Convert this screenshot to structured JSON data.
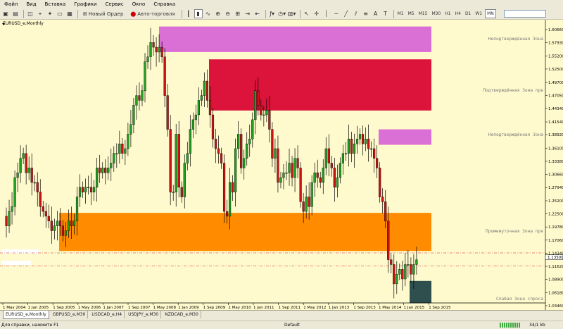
{
  "menu": [
    "Файл",
    "Вид",
    "Вставка",
    "Графики",
    "Сервис",
    "Окно",
    "Справка"
  ],
  "toolbar": {
    "new_order": "Новый Ордер",
    "auto_trading": "Авто-торговля",
    "timeframes": [
      "M1",
      "M5",
      "M15",
      "M30",
      "H1",
      "H4",
      "D1",
      "W1",
      "MN"
    ],
    "active_timeframe": "MN"
  },
  "chart": {
    "title": "EURUSD_e,Monthly",
    "price_labels": [
      "1.60660",
      "1.57930",
      "1.55200",
      "1.52500",
      "1.49700",
      "1.47050",
      "1.44340",
      "1.41540",
      "1.38920",
      "1.36100",
      "1.33380",
      "1.30660",
      "1.27940",
      "1.25200",
      "1.22500",
      "1.19780",
      "1.17060",
      "1.14340",
      "1.11620",
      "1.08900",
      "1.06180",
      "1.03460"
    ],
    "current_price": "1.13500",
    "date_labels": [
      "1 May 2004",
      "1 Jan 2005",
      "1 Sep 2005",
      "1 May 2006",
      "1 Jan 2007",
      "1 Sep 2007",
      "1 May 2008",
      "1 Jan 2009",
      "1 Sep 2009",
      "1 May 2010",
      "1 Jan 2011",
      "1 Sep 2011",
      "1 May 2012",
      "1 Jan 2013",
      "1 Sep 2013",
      "1 May 2014",
      "1 Jan 2015",
      "1 Sep 2015"
    ],
    "zones": [
      {
        "label": "Неподтверждённая Зона",
        "color": "#da70d6"
      },
      {
        "label": "Подтверждённая Зона пре",
        "color": "#dc143c"
      },
      {
        "label": "Неподтверждённая Зона",
        "color": "#da70d6"
      },
      {
        "label": "Промежуточная Зона пре",
        "color": "#ff8c00"
      },
      {
        "label": "Слабая Зона спроса",
        "color": "#2f4f4f"
      }
    ],
    "colors": {
      "background": "#fffacd",
      "bull": "#22a022",
      "bear": "#c81414"
    }
  },
  "tabs": [
    "EURUSD_e,Monthly",
    "GBPUSD_e,M30",
    "USDCAD_e,H4",
    "USDJPY_e,M30",
    "NZDCAD_e,M30"
  ],
  "active_tab": "EURUSD_e,Monthly",
  "status": {
    "help": "Для справки, нажмите F1",
    "profile": "Default",
    "traffic": "34/1 kb"
  }
}
